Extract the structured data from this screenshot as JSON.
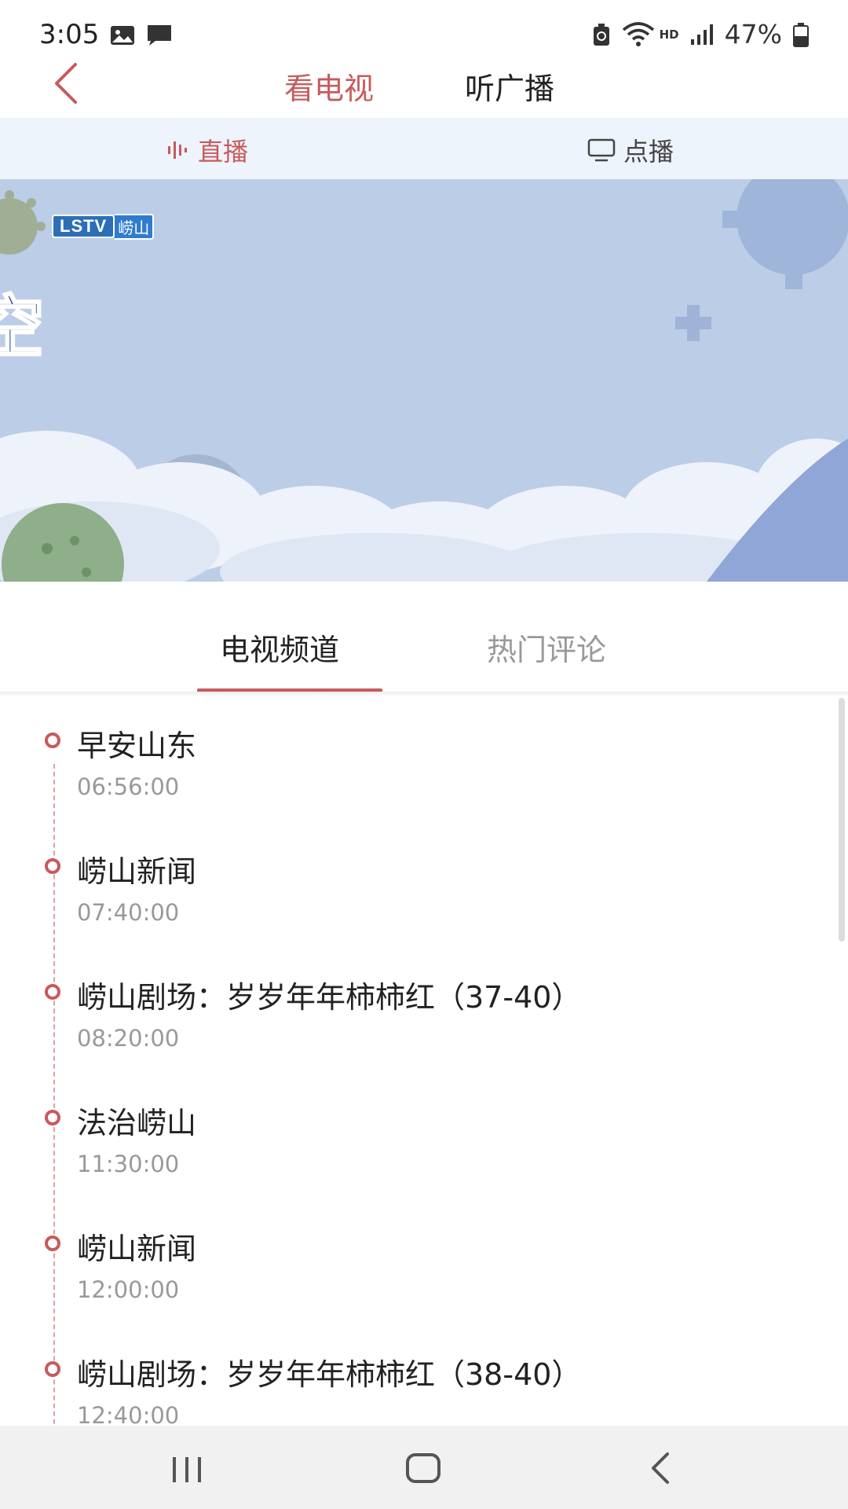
{
  "status_bar": {
    "time": "3:05",
    "battery": "47%",
    "hd": "HD"
  },
  "header": {
    "tabs": [
      {
        "label": "看电视",
        "active": true
      },
      {
        "label": "听广播",
        "active": false
      }
    ]
  },
  "subnav": {
    "live_label": "直播",
    "vod_label": "点播"
  },
  "video": {
    "logo_text": "LSTV",
    "logo_cn": "崂山",
    "overlay_char": "空"
  },
  "content_tabs": {
    "channel": "电视频道",
    "comments": "热门评论"
  },
  "programs": [
    {
      "title": "早安山东",
      "time": "06:56:00"
    },
    {
      "title": "崂山新闻",
      "time": "07:40:00"
    },
    {
      "title": "崂山剧场：岁岁年年柿柿红（37-40）",
      "time": "08:20:00"
    },
    {
      "title": "法治崂山",
      "time": "11:30:00"
    },
    {
      "title": "崂山新闻",
      "time": "12:00:00"
    },
    {
      "title": "崂山剧场：岁岁年年柿柿红（38-40）",
      "time": "12:40:00"
    }
  ],
  "colors": {
    "accent": "#c85a5c",
    "subnav_bg": "#eef4fb",
    "video_bg": "#b9cbe6"
  }
}
